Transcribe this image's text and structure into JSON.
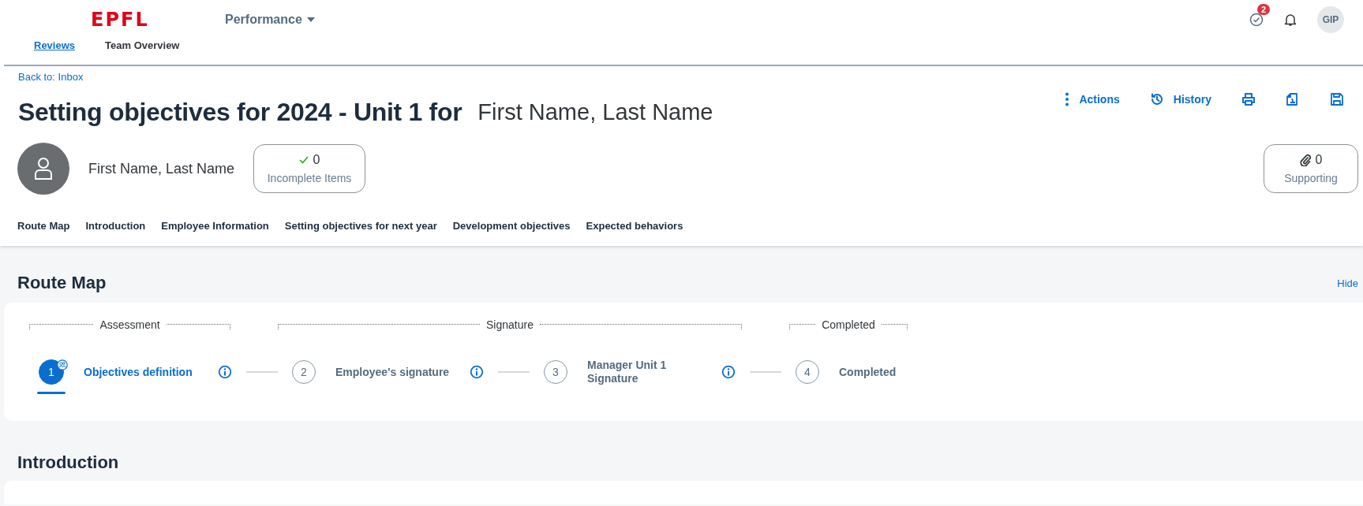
{
  "app": {
    "brand": "EPFL",
    "module": "Performance"
  },
  "header": {
    "tasks_badge": "2",
    "avatar": "GIP"
  },
  "tabs": [
    {
      "label": "Reviews",
      "selected": true
    },
    {
      "label": "Team Overview",
      "selected": false
    }
  ],
  "back_link": "Back to: Inbox",
  "title": {
    "document": "Setting objectives for 2024 - Unit 1 for",
    "subject": "First Name, Last Name"
  },
  "actions": [
    {
      "kind": "menu",
      "label": "Actions"
    },
    {
      "kind": "history",
      "label": "History"
    },
    {
      "kind": "print"
    },
    {
      "kind": "pdf"
    },
    {
      "kind": "save"
    }
  ],
  "employee": {
    "name": "First Name, Last Name"
  },
  "counters": [
    {
      "kind": "check",
      "count": "0",
      "label": "Incomplete Items"
    },
    {
      "kind": "attachment",
      "count": "0",
      "label": "Supporting"
    }
  ],
  "section_nav": [
    {
      "label": "Route Map"
    },
    {
      "label": "Introduction"
    },
    {
      "label": "Employee Information"
    },
    {
      "label": "Setting objectives for next year"
    },
    {
      "label": "Development objectives"
    },
    {
      "label": "Expected behaviors"
    }
  ],
  "route_map": {
    "title": "Route Map",
    "toggle": "Hide",
    "phases": [
      {
        "label": "Assessment"
      },
      {
        "label": "Signature"
      },
      {
        "label": "Completed"
      }
    ],
    "steps": [
      {
        "number": "1",
        "label": "Objectives definition",
        "selected": true,
        "assigned": true,
        "info": true
      },
      {
        "number": "2",
        "label": "Employee's signature",
        "selected": false,
        "assigned": false,
        "info": true
      },
      {
        "number": "3",
        "label": "Manager Unit 1 Signature",
        "selected": false,
        "assigned": false,
        "info": true
      },
      {
        "number": "4",
        "label": "Completed",
        "selected": false,
        "assigned": false,
        "info": false
      }
    ]
  },
  "sections": [
    {
      "title": "Introduction"
    }
  ]
}
